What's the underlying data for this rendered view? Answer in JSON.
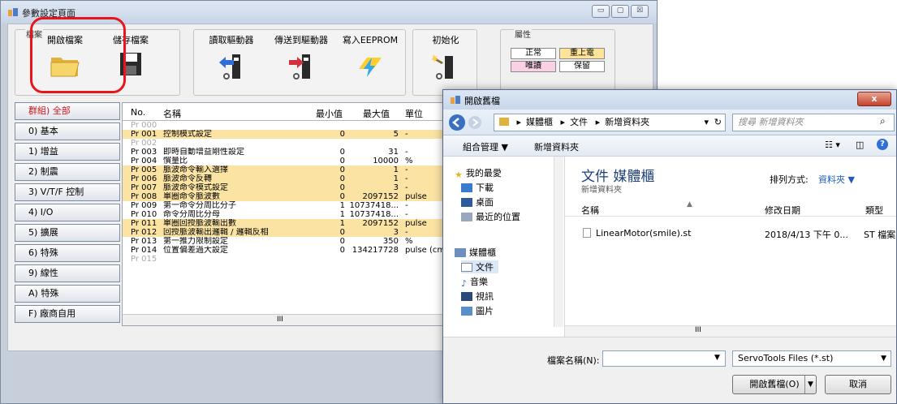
{
  "main_window": {
    "title": "參數設定頁面",
    "caption": {
      "minimize": "▭",
      "maximize": "▢",
      "close": "☒"
    }
  },
  "toolbar": {
    "file_group_label": "檔案",
    "open_file": "開啟檔案",
    "save_file": "儲存檔案",
    "read_driver": "讀取驅動器",
    "send_driver": "傳送到驅動器",
    "write_eeprom": "寫入EEPROM",
    "initialize": "初始化"
  },
  "attributes": {
    "label": "屬性",
    "normal": "正常",
    "repower": "重上電",
    "readonly": "唯讀",
    "reserved": "保留",
    "colors": {
      "normal": "#ffffff",
      "repower": "#fde49a",
      "readonly": "#f8d1e5",
      "reserved": "#ffffff"
    }
  },
  "groups": [
    {
      "label": "群組) 全部",
      "active": true
    },
    {
      "label": "0) 基本"
    },
    {
      "label": "1) 增益"
    },
    {
      "label": "2) 制震"
    },
    {
      "label": "3) V/T/F 控制"
    },
    {
      "label": "4) I/O"
    },
    {
      "label": "5) 擴展"
    },
    {
      "label": "6) 特殊"
    },
    {
      "label": "9) 線性"
    },
    {
      "label": "A) 特殊"
    },
    {
      "label": "F) 廠商自用"
    }
  ],
  "table": {
    "headers": {
      "no": "No.",
      "name": "名稱",
      "min": "最小值",
      "max": "最大值",
      "unit": "單位"
    },
    "rows": [
      {
        "no": "Pr 000",
        "name": "",
        "min": "",
        "max": "",
        "unit": "",
        "style": "gray"
      },
      {
        "no": "Pr 001",
        "name": "控制模式設定",
        "min": "0",
        "max": "5",
        "unit": "-",
        "style": "hl"
      },
      {
        "no": "Pr 002",
        "name": "",
        "min": "",
        "max": "",
        "unit": "",
        "style": "gray"
      },
      {
        "no": "Pr 003",
        "name": "即時自動增益剛性設定",
        "min": "0",
        "max": "31",
        "unit": "-",
        "style": ""
      },
      {
        "no": "Pr 004",
        "name": "慣量比",
        "min": "0",
        "max": "10000",
        "unit": "%",
        "style": ""
      },
      {
        "no": "Pr 005",
        "name": "脈波命令輸入選擇",
        "min": "0",
        "max": "1",
        "unit": "-",
        "style": "hl"
      },
      {
        "no": "Pr 006",
        "name": "脈波命令反轉",
        "min": "0",
        "max": "1",
        "unit": "-",
        "style": "hl"
      },
      {
        "no": "Pr 007",
        "name": "脈波命令模式設定",
        "min": "0",
        "max": "3",
        "unit": "-",
        "style": "hl"
      },
      {
        "no": "Pr 008",
        "name": "單圈命令脈波數",
        "min": "0",
        "max": "2097152",
        "unit": "pulse",
        "style": "hl"
      },
      {
        "no": "Pr 009",
        "name": "第一命令分周比分子",
        "min": "1",
        "max": "10737418...",
        "unit": "-",
        "style": ""
      },
      {
        "no": "Pr 010",
        "name": "命令分周比分母",
        "min": "1",
        "max": "10737418...",
        "unit": "-",
        "style": ""
      },
      {
        "no": "Pr 011",
        "name": "單圈回授脈波輸出數",
        "min": "1",
        "max": "2097152",
        "unit": "pulse",
        "style": "hl"
      },
      {
        "no": "Pr 012",
        "name": "回授脈波輸出邏輯 / 邏輯反相",
        "min": "0",
        "max": "3",
        "unit": "-",
        "style": "hl"
      },
      {
        "no": "Pr 013",
        "name": "第一推力限制設定",
        "min": "0",
        "max": "350",
        "unit": "%",
        "style": ""
      },
      {
        "no": "Pr 014",
        "name": "位置偏差過大設定",
        "min": "0",
        "max": "134217728",
        "unit": "pulse (cmd",
        "style": ""
      },
      {
        "no": "Pr 015",
        "name": "",
        "min": "",
        "max": "",
        "unit": "",
        "style": "gray"
      }
    ],
    "scroll_mark": "III"
  },
  "open_dialog": {
    "title": "開啟舊檔",
    "breadcrumb": [
      "媒體櫃",
      "文件",
      "新增資料夾"
    ],
    "search_placeholder": "搜尋 新增資料夾",
    "organize": "組合管理 ▼",
    "new_folder": "新增資料夾",
    "nav": {
      "favorites": "我的最愛",
      "downloads": "下載",
      "desktop": "桌面",
      "recent": "最近的位置",
      "libraries": "媒體櫃",
      "documents": "文件",
      "music": "音樂",
      "videos": "視訊",
      "pictures": "圖片"
    },
    "library_title": "文件 媒體櫃",
    "library_sub": "新增資料夾",
    "sort_label": "排列方式:",
    "sort_value": "資料夾 ▼",
    "columns": {
      "name": "名稱",
      "date": "修改日期",
      "type": "類型"
    },
    "files": [
      {
        "name": "LinearMotor(smile).st",
        "date": "2018/4/13 下午 0...",
        "type": "ST 檔案"
      }
    ],
    "filename_label": "檔案名稱(N):",
    "filename_value": "",
    "filter": "ServoTools Files (*.st)",
    "open_btn": "開啟舊檔(O)",
    "cancel_btn": "取消"
  }
}
